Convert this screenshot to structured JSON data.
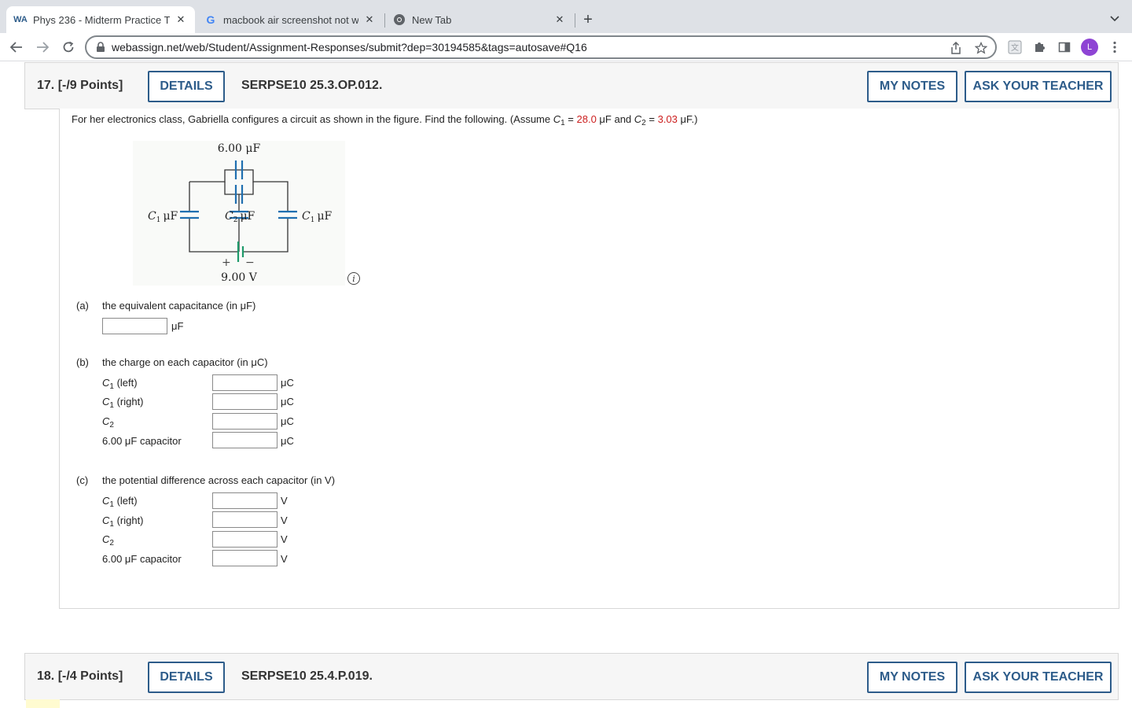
{
  "browser": {
    "tabs": [
      {
        "title": "Phys 236 - Midterm Practice T",
        "favicon": "WA",
        "active": true
      },
      {
        "title": "macbook air screenshot not wo",
        "favicon": "G",
        "active": false
      },
      {
        "title": "New Tab",
        "favicon": "chrome-icon",
        "active": false
      }
    ],
    "url": "webassign.net/web/Student/Assignment-Responses/submit?dep=30194585&tags=autosave#Q16",
    "avatar_letter": "L"
  },
  "q17": {
    "number": "17.",
    "points": "[-/9 Points]",
    "details": "DETAILS",
    "code": "SERPSE10 25.3.OP.012.",
    "my_notes": "MY NOTES",
    "ask_teacher": "ASK YOUR TEACHER",
    "intro": {
      "before": "For her electronics class, Gabriella configures a circuit as shown in the figure. Find the following. (Assume ",
      "c1_sym": "C",
      "c1_sub": "1",
      "eq1": " = ",
      "c1_val": "28.0",
      "mid": " μF and ",
      "c2_sym": "C",
      "c2_sub": "2",
      "eq2": " = ",
      "c2_val": "3.03",
      "end": " μF.)"
    },
    "figure": {
      "top_cap": "6.00 μF",
      "left_cap_sym": "C",
      "left_cap_sub": "1",
      "left_cap_unit": "μF",
      "mid_cap_sym": "C",
      "mid_cap_sub": "2",
      "mid_cap_unit": "μF",
      "right_cap_sym": "C",
      "right_cap_sub": "1",
      "right_cap_unit": "μF",
      "battery_plus": "+",
      "battery_minus": "−",
      "battery_voltage": "9.00 V",
      "info": "i"
    },
    "part_a": {
      "label": "(a)",
      "text": "the equivalent capacitance (in μF)",
      "unit": "μF",
      "value": ""
    },
    "part_b": {
      "label": "(b)",
      "text": "the charge on each capacitor (in μC)",
      "rows": [
        {
          "sym": "C",
          "sub": "1",
          "suffix": " (left)",
          "unit": "μC",
          "value": ""
        },
        {
          "sym": "C",
          "sub": "1",
          "suffix": " (right)",
          "unit": "μC",
          "value": ""
        },
        {
          "sym": "C",
          "sub": "2",
          "suffix": "",
          "unit": "μC",
          "value": ""
        },
        {
          "sym": "6.00 μF capacitor",
          "sub": "",
          "suffix": "",
          "unit": "μC",
          "value": ""
        }
      ]
    },
    "part_c": {
      "label": "(c)",
      "text": "the potential difference across each capacitor (in V)",
      "rows": [
        {
          "sym": "C",
          "sub": "1",
          "suffix": " (left)",
          "unit": "V",
          "value": ""
        },
        {
          "sym": "C",
          "sub": "1",
          "suffix": " (right)",
          "unit": "V",
          "value": ""
        },
        {
          "sym": "C",
          "sub": "2",
          "suffix": "",
          "unit": "V",
          "value": ""
        },
        {
          "sym": "6.00 μF capacitor",
          "sub": "",
          "suffix": "",
          "unit": "V",
          "value": ""
        }
      ]
    }
  },
  "q18": {
    "number": "18.",
    "points": "[-/4 Points]",
    "details": "DETAILS",
    "code": "SERPSE10 25.4.P.019.",
    "my_notes": "MY NOTES",
    "ask_teacher": "ASK YOUR TEACHER"
  },
  "colors": {
    "accent": "#2d5c8a",
    "given_value": "#cc1f1f",
    "capacitor_plate": "#1f6fb0",
    "battery": "#1e9a6a"
  }
}
